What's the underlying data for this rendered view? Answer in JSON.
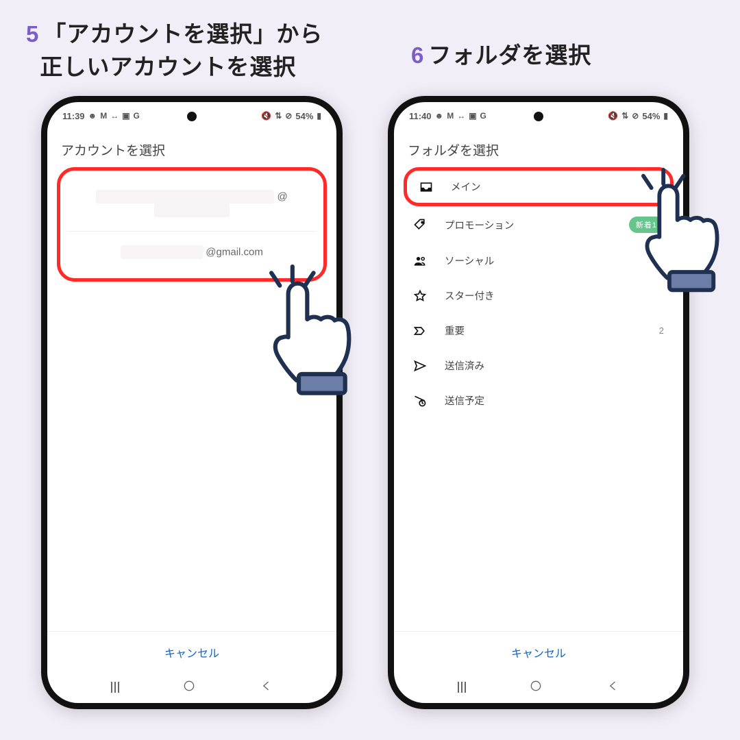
{
  "step5": {
    "number": "5",
    "line1": "「アカウントを選択」から",
    "line2": "正しいアカウントを選択"
  },
  "step6": {
    "number": "6",
    "title": "フォルダを選択"
  },
  "phone_left": {
    "statusbar": {
      "time": "11:39",
      "battery": "54%"
    },
    "title": "アカウントを選択",
    "accounts": [
      {
        "prefix_hidden": true,
        "at": "@",
        "domain_hidden": true
      },
      {
        "prefix_hidden": true,
        "at": "@gmail.com",
        "domain_hidden": false
      }
    ],
    "cancel": "キャンセル"
  },
  "phone_right": {
    "statusbar": {
      "time": "11:40",
      "battery": "54%"
    },
    "title": "フォルダを選択",
    "folders": {
      "main": {
        "label": "メイン"
      },
      "promo": {
        "label": "プロモーション",
        "badge": "新着1"
      },
      "social": {
        "label": "ソーシャル"
      },
      "starred": {
        "label": "スター付き"
      },
      "important": {
        "label": "重要",
        "trailing": "2"
      },
      "sent": {
        "label": "送信済み"
      },
      "scheduled": {
        "label": "送信予定"
      }
    },
    "cancel": "キャンセル"
  },
  "colors": {
    "highlight": "#ff2b2b",
    "link": "#1565c0",
    "step_accent": "#7a5ec5",
    "badge": "#66c58d"
  }
}
